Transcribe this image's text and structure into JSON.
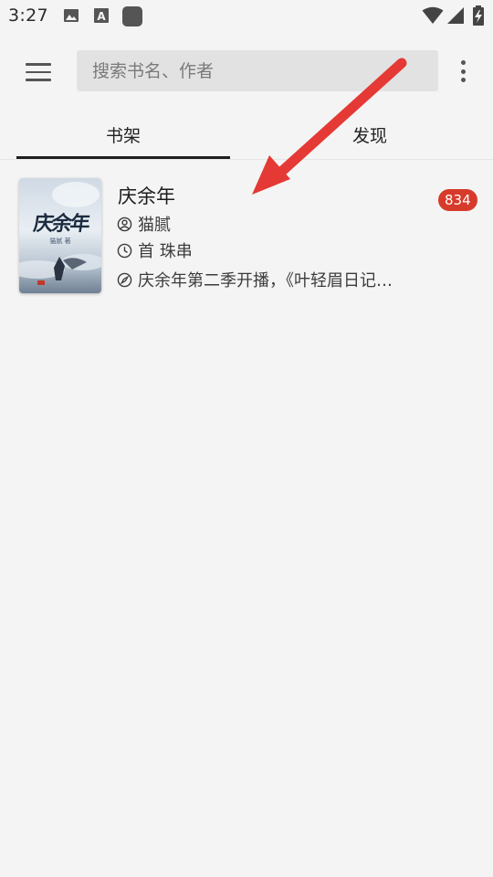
{
  "status_bar": {
    "time": "3:27",
    "icons": [
      "image-notification-icon",
      "font-notification-icon",
      "app-notification-icon",
      "wifi-icon",
      "cellular-signal-icon",
      "battery-charging-icon"
    ]
  },
  "header": {
    "menu_icon": "hamburger-menu-icon",
    "search": {
      "placeholder": "搜索书名、作者",
      "value": ""
    },
    "more_icon": "more-vertical-icon"
  },
  "tabs": [
    {
      "label": "书架",
      "active": true
    },
    {
      "label": "发现",
      "active": false
    }
  ],
  "bookshelf": {
    "books": [
      {
        "title": "庆余年",
        "cover_title": "庆余年",
        "cover_author": "猫腻 著",
        "unread_count": "834",
        "author": "猫腻",
        "current_chapter": "首 珠串",
        "latest_chapter": "庆余年第二季开播，《叶轻眉日记…",
        "icons": {
          "author": "person-icon",
          "chapter": "clock-icon",
          "latest": "compass-icon"
        }
      }
    ]
  },
  "annotation": {
    "arrow_color": "#e53935"
  },
  "colors": {
    "background": "#f4f4f4",
    "search_bg": "#e2e2e2",
    "badge": "#d63a2b",
    "tab_indicator": "#1e1e1e"
  }
}
